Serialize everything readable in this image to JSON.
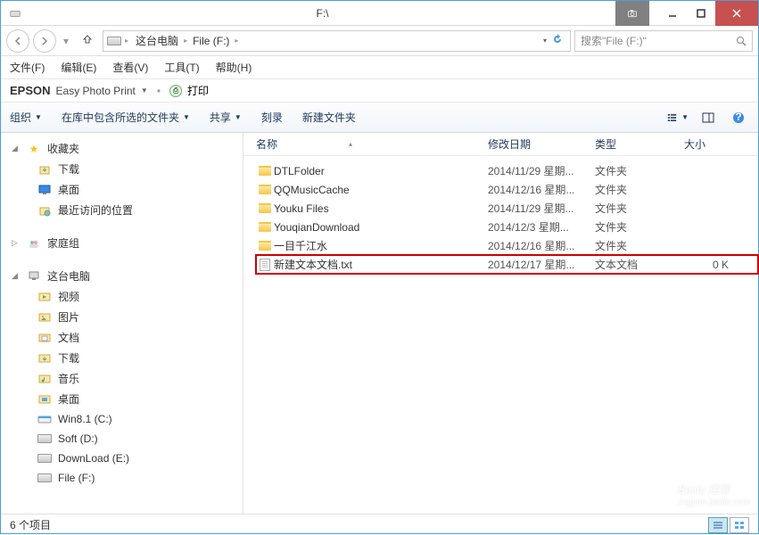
{
  "title": "F:\\",
  "breadcrumb": {
    "root": "这台电脑",
    "location": "File (F:)"
  },
  "search_placeholder": "搜索\"File (F:)\"",
  "menu": {
    "file": "文件(F)",
    "edit": "编辑(E)",
    "view": "查看(V)",
    "tools": "工具(T)",
    "help": "帮助(H)"
  },
  "epson": {
    "brand": "EPSON",
    "text": "Easy Photo Print",
    "print": "打印"
  },
  "toolbar": {
    "organize": "组织",
    "include": "在库中包含所选的文件夹",
    "share": "共享",
    "burn": "刻录",
    "new_folder": "新建文件夹"
  },
  "columns": {
    "name": "名称",
    "date": "修改日期",
    "type": "类型",
    "size": "大小"
  },
  "tree": {
    "favorites": {
      "label": "收藏夹",
      "downloads": "下载",
      "desktop": "桌面",
      "recent": "最近访问的位置"
    },
    "homegroup": "家庭组",
    "this_pc": {
      "label": "这台电脑",
      "videos": "视频",
      "pictures": "图片",
      "documents": "文档",
      "downloads": "下载",
      "music": "音乐",
      "desktop": "桌面",
      "c": "Win8.1 (C:)",
      "d": "Soft (D:)",
      "e": "DownLoad (E:)",
      "f": "File (F:)"
    }
  },
  "files": [
    {
      "name": "DTLFolder",
      "date": "2014/11/29 星期...",
      "type": "文件夹",
      "size": "",
      "icon": "folder"
    },
    {
      "name": "QQMusicCache",
      "date": "2014/12/16 星期...",
      "type": "文件夹",
      "size": "",
      "icon": "folder"
    },
    {
      "name": "Youku Files",
      "date": "2014/11/29 星期...",
      "type": "文件夹",
      "size": "",
      "icon": "folder"
    },
    {
      "name": "YouqianDownload",
      "date": "2014/12/3 星期...",
      "type": "文件夹",
      "size": "",
      "icon": "folder"
    },
    {
      "name": "一目千江水",
      "date": "2014/12/16 星期...",
      "type": "文件夹",
      "size": "",
      "icon": "folder"
    },
    {
      "name": "新建文本文档.txt",
      "date": "2014/12/17 星期...",
      "type": "文本文档",
      "size": "0 K",
      "icon": "txt",
      "highlighted": true
    }
  ],
  "statusbar": "6 个项目",
  "watermark": {
    "main": "Baidu 经验",
    "sub": "jingyan.baidu.com"
  }
}
